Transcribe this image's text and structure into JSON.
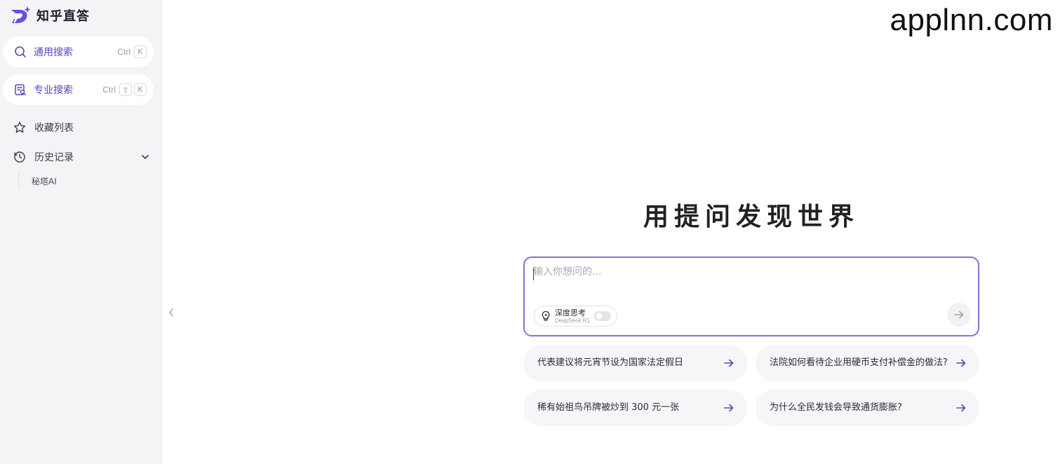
{
  "brand": {
    "name": "知乎直答",
    "logo_icon": "zhida-logo-icon"
  },
  "sidebar": {
    "general_search": {
      "label": "通用搜索",
      "shortcut_ctrl": "Ctrl",
      "shortcut_key": "K"
    },
    "pro_search": {
      "label": "专业搜索",
      "shortcut_ctrl": "Ctrl",
      "shortcut_shift": "⇧",
      "shortcut_key": "K"
    },
    "favorites": {
      "label": "收藏列表"
    },
    "history": {
      "label": "历史记录",
      "items": [
        {
          "label": "秘塔AI"
        }
      ]
    }
  },
  "watermark": "applnn.com",
  "main": {
    "headline": "用提问发现世界",
    "ask": {
      "placeholder": "输入你想问的...",
      "deep_think_label": "深度思考",
      "deep_think_model": "DeepSeek R1",
      "deep_think_enabled": false
    },
    "suggestions": [
      {
        "text": "代表建议将元宵节设为国家法定假日"
      },
      {
        "text": "法院如何看待企业用硬币支付补偿金的做法?"
      },
      {
        "text": "稀有始祖鸟吊牌被炒到 300 元一张"
      },
      {
        "text": "为什么全民发钱会导致通货膨胀?"
      }
    ]
  },
  "colors": {
    "accent": "#5a45b8",
    "border_accent": "#8b6fe0",
    "sidebar_bg": "#f4f4f7"
  }
}
